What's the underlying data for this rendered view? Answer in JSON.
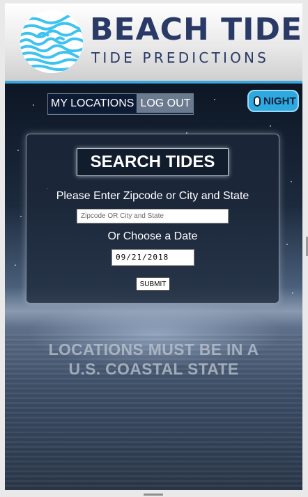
{
  "brand": {
    "title": "BEACH TIDES",
    "subtitle": "TIDE PREDICTIONS",
    "logo_icon": "fingerprint-wave-logo",
    "color": "#2a3a66",
    "accent": "#3aa6dc"
  },
  "nav": {
    "my_locations_label": "MY LOCATIONS",
    "logout_label": "LOG OUT"
  },
  "night_toggle": {
    "label": "NIGHT",
    "color": "#2da9e0"
  },
  "search": {
    "title": "SEARCH TIDES",
    "location_prompt": "Please Enter Zipcode or City and State",
    "location_placeholder": "Zipcode OR City and State",
    "location_value": "",
    "date_prompt": "Or Choose a Date",
    "date_value": "09/21/2018",
    "submit_label": "SUBMIT"
  },
  "notice": {
    "line1": "LOCATIONS MUST BE IN A",
    "line2": "U.S. COASTAL STATE"
  }
}
